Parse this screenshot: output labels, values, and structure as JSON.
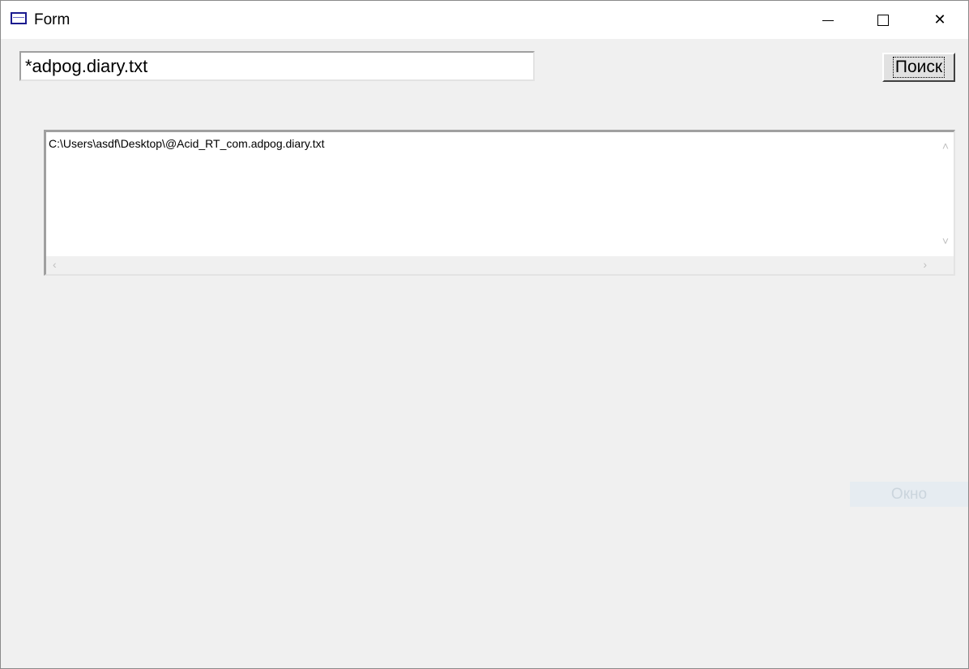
{
  "window": {
    "title": "Form",
    "icon": "window-icon",
    "controls": {
      "minimize": "minimize-icon",
      "maximize": "maximize-icon",
      "close_symbol": "✕"
    }
  },
  "search": {
    "value": "*adpog.diary.txt",
    "button_label": "Поиск"
  },
  "results": {
    "lines": [
      "C:\\Users\\asdf\\Desktop\\@Acid_RT_com.adpog.diary.txt"
    ],
    "text": "C:\\Users\\asdf\\Desktop\\@Acid_RT_com.adpog.diary.txt"
  },
  "footer": {
    "ok_label": "Окно"
  },
  "colors": {
    "background": "#f0f0f0",
    "titlebar": "#ffffff",
    "icon_accent": "#1b1b8f",
    "disabled_button": "#e6ecf1"
  }
}
